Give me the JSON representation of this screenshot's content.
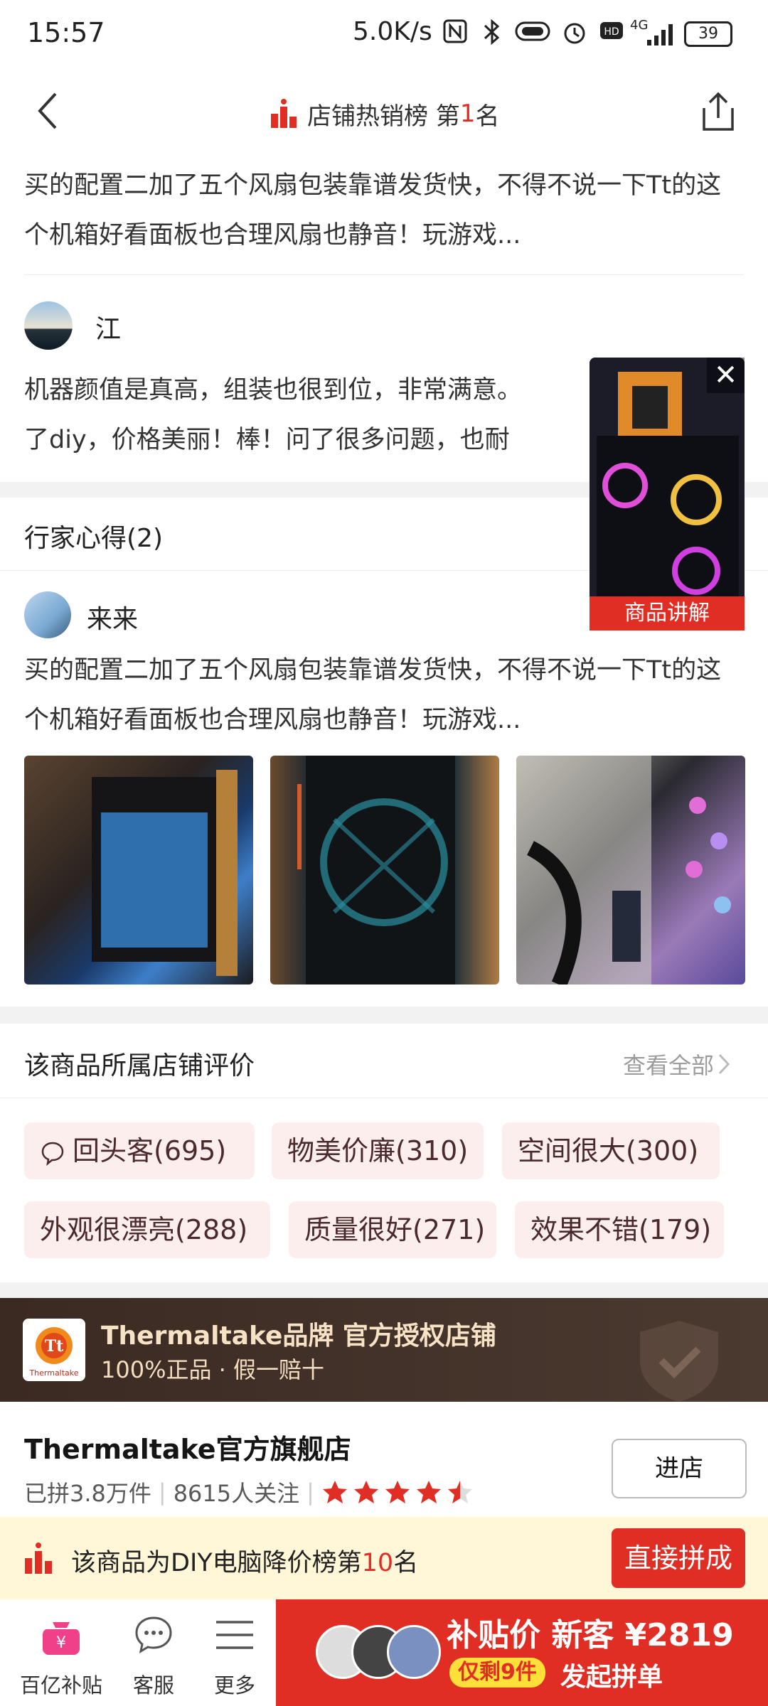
{
  "status_bar": {
    "time": "15:57",
    "net_speed": "5.0K/s",
    "network": "4G",
    "battery": "39"
  },
  "header": {
    "rank_label": "店铺热销榜 第",
    "rank_num": "1",
    "rank_suffix": "名"
  },
  "reviews_top": [
    {
      "text": "买的配置二加了五个风扇包装靠谱发货快，不得不说一下Tt的这个机箱好看面板也合理风扇也静音！玩游戏..."
    },
    {
      "user": "江",
      "text": "机器颜值是真高，组装也很到位，非常满意。",
      "text2": "了diy，价格美丽！棒！问了很多问题，也耐"
    }
  ],
  "expert": {
    "title": "行家心得(2)",
    "user": "来来",
    "text": "买的配置二加了五个风扇包装靠谱发货快，不得不说一下Tt的这个机箱好看面板也合理风扇也静音！玩游戏..."
  },
  "float_video": {
    "label": "商品讲解"
  },
  "shop_reviews": {
    "title": "该商品所属店铺评价",
    "view_all": "查看全部",
    "tags": [
      {
        "label": "回头客(695)",
        "icon": "speech-bubble-icon"
      },
      {
        "label": "物美价廉(310)"
      },
      {
        "label": "空间很大(300)"
      },
      {
        "label": "外观很漂亮(288)"
      },
      {
        "label": "质量很好(271)"
      },
      {
        "label": "效果不错(179)"
      }
    ]
  },
  "brand": {
    "title": "Thermaltake品牌 官方授权店铺",
    "subtitle": "100%正品 · 假一赔十",
    "logo_text": "Thermaltake"
  },
  "store": {
    "name": "Thermaltake官方旗舰店",
    "sold": "已拼3.8万件",
    "followers": "8615人关注",
    "rating": 4.5,
    "enter_label": "进店"
  },
  "promo": {
    "text_prefix": "该商品为DIY电脑降价榜第",
    "rank": "10",
    "text_suffix": "名",
    "button": "直接拼成"
  },
  "bottom_nav": {
    "items": [
      {
        "label": "百亿补贴",
        "icon": "subsidy-bag-icon"
      },
      {
        "label": "客服",
        "icon": "chat-icon"
      },
      {
        "label": "更多",
        "icon": "menu-icon"
      }
    ],
    "price_line": "补贴价 新客 ¥2819",
    "stock_left": "仅剩9件",
    "action": "发起拼单"
  },
  "colors": {
    "accent": "#e02e24",
    "brand_bg": "#3b2a22",
    "promo_bg": "#fff7d8",
    "tag_bg": "#fdeeee"
  }
}
